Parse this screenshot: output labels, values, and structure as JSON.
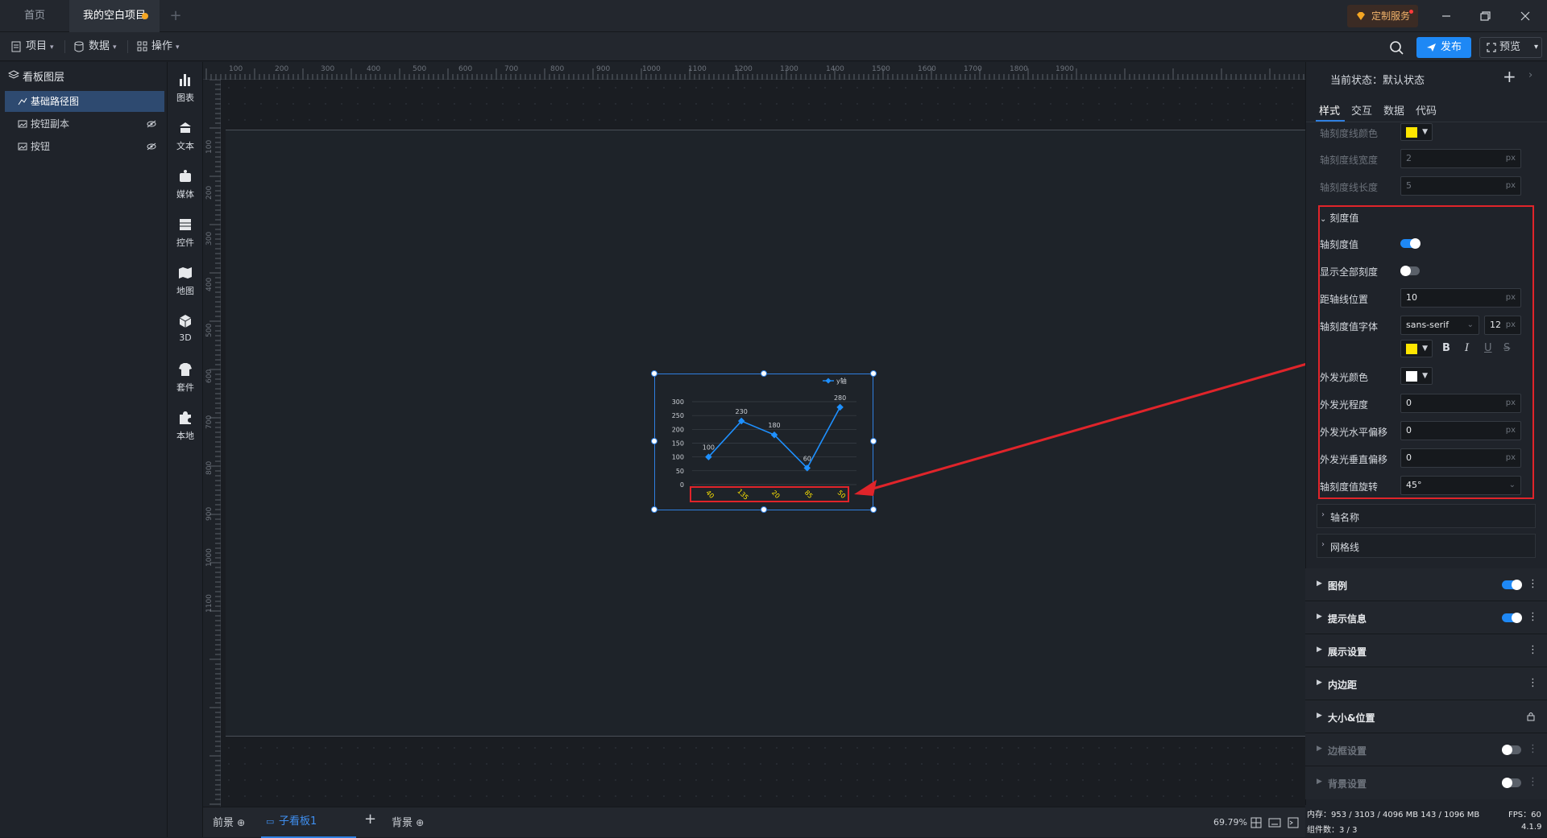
{
  "titlebar": {
    "tab_home": "首页",
    "tab_project": "我的空白项目",
    "custom_service": "定制服务"
  },
  "toolbar": {
    "menu_project": "项目",
    "menu_data": "数据",
    "menu_ops": "操作",
    "publish": "发布",
    "preview": "预览"
  },
  "layers": {
    "title": "看板图层",
    "items": [
      {
        "label": "基础路径图"
      },
      {
        "label": "按钮副本"
      },
      {
        "label": "按钮"
      }
    ]
  },
  "components": [
    {
      "label": "图表",
      "icon": "bar-chart-icon"
    },
    {
      "label": "文本",
      "icon": "text-icon"
    },
    {
      "label": "媒体",
      "icon": "media-icon"
    },
    {
      "label": "控件",
      "icon": "widget-icon"
    },
    {
      "label": "地图",
      "icon": "map-icon"
    },
    {
      "label": "3D",
      "icon": "cube-icon"
    },
    {
      "label": "套件",
      "icon": "kit-icon"
    },
    {
      "label": "本地",
      "icon": "puzzle-icon"
    }
  ],
  "ruler": {
    "top": [
      "100",
      "200",
      "300",
      "400",
      "500",
      "600",
      "700",
      "800",
      "900",
      "1000",
      "1100",
      "1200",
      "1300",
      "1400",
      "1500",
      "1600",
      "1700",
      "1800",
      "1900"
    ],
    "left": [
      "100",
      "200",
      "300",
      "400",
      "500",
      "600",
      "700",
      "800",
      "900",
      "1000",
      "1100"
    ]
  },
  "chart_data": {
    "type": "line",
    "categories": [
      "x1",
      "x2",
      "x3",
      "x4",
      "x5"
    ],
    "tick_labels_rotated": [
      "40",
      "135",
      "20",
      "85",
      "50"
    ],
    "series": [
      {
        "name": "y轴",
        "values": [
          100,
          230,
          180,
          60,
          280
        ]
      }
    ],
    "y_ticks": [
      "300",
      "250",
      "200",
      "150",
      "100",
      "50",
      "0"
    ],
    "ylim": [
      0,
      300
    ],
    "point_labels": [
      "100",
      "230",
      "180",
      "60",
      "280"
    ],
    "line_color": "#1e90ff",
    "tick_label_color": "#ffe600",
    "legend": "top-right"
  },
  "bottom": {
    "foreground": "前景",
    "subboard": "子看板1",
    "background": "背景",
    "zoom": "69.79%"
  },
  "panel": {
    "state": "当前状态：默认状态",
    "tabs": [
      "样式",
      "交互",
      "数据",
      "代码"
    ],
    "rows_top": [
      {
        "label": "轴刻度线颜色",
        "color": "#ffe600"
      },
      {
        "label": "轴刻度线宽度",
        "value": "2",
        "unit": "px"
      },
      {
        "label": "轴刻度线长度",
        "value": "5",
        "unit": "px"
      }
    ],
    "section_ticks": "刻度值",
    "tick_rows": {
      "show_ticks": "轴刻度值",
      "show_all": "显示全部刻度",
      "offset_label": "距轴线位置",
      "offset_value": "10",
      "font_label": "轴刻度值字体",
      "font_value": "sans-serif",
      "font_size": "12",
      "font_color": "#ffe600",
      "glow_color_label": "外发光颜色",
      "glow_color": "#ffffff",
      "glow_level_label": "外发光程度",
      "glow_level": "0",
      "glow_x_label": "外发光水平偏移",
      "glow_x": "0",
      "glow_y_label": "外发光垂直偏移",
      "glow_y": "0",
      "rotate_label": "轴刻度值旋转",
      "rotate_value": "45°",
      "unit": "px"
    },
    "section_axis_name": "轴名称",
    "section_grid": "网格线",
    "groups": [
      {
        "label": "图例",
        "toggle": true,
        "on": true,
        "dim": false
      },
      {
        "label": "提示信息",
        "toggle": true,
        "on": true,
        "dim": false
      },
      {
        "label": "展示设置",
        "toggle": false,
        "dim": false
      },
      {
        "label": "内边距",
        "toggle": false,
        "dim": false
      },
      {
        "label": "大小&位置",
        "toggle": false,
        "lock": true,
        "dim": false
      },
      {
        "label": "边框设置",
        "toggle": true,
        "on": false,
        "dim": true
      },
      {
        "label": "背景设置",
        "toggle": true,
        "on": false,
        "dim": true
      }
    ]
  },
  "status": {
    "memory": "内存：953 / 3103 / 4096 MB  143 / 1096 MB",
    "fps": "FPS：60",
    "components": "组件数：3 / 3",
    "version": "4.1.9"
  }
}
